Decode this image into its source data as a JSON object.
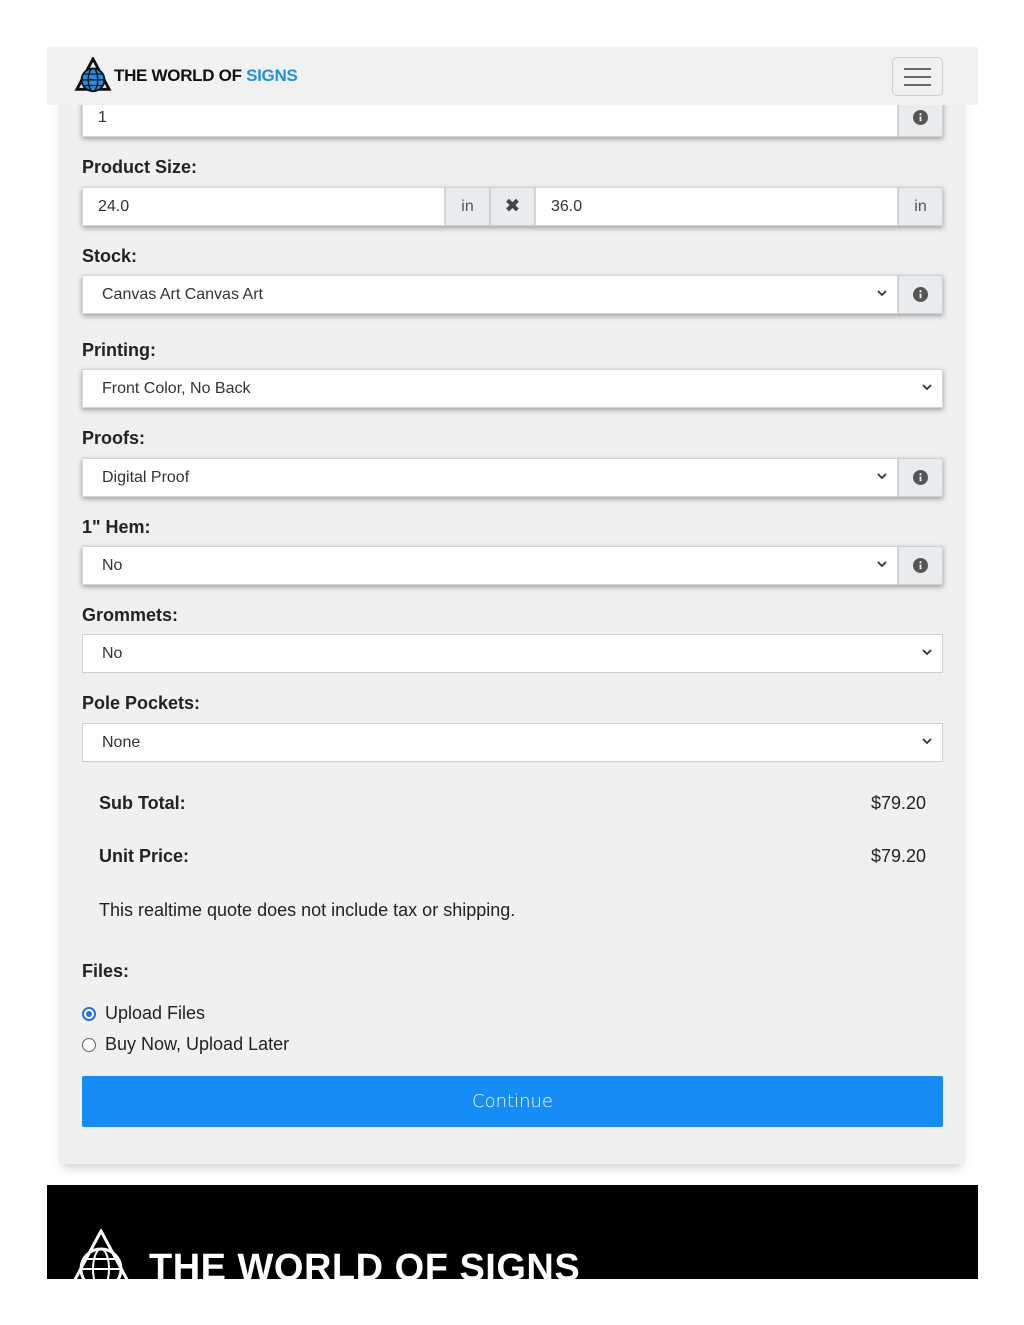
{
  "header": {
    "logo_dark": "THE WORLD OF ",
    "logo_blue": "SIGNS"
  },
  "form": {
    "quantity_value": "1",
    "product_size": {
      "label": "Product Size:",
      "width": "24.0",
      "width_unit": "in",
      "height": "36.0",
      "height_unit": "in",
      "times_symbol": "✖"
    },
    "stock": {
      "label": "Stock:",
      "value": "Canvas Art Canvas Art"
    },
    "printing": {
      "label": "Printing:",
      "value": "Front Color, No Back"
    },
    "proofs": {
      "label": "Proofs:",
      "value": "Digital Proof"
    },
    "hem": {
      "label": "1\" Hem:",
      "value": "No"
    },
    "grommets": {
      "label": "Grommets:",
      "value": "No"
    },
    "pole_pockets": {
      "label": "Pole Pockets:",
      "value": "None"
    }
  },
  "totals": {
    "subtotal_label": "Sub Total:",
    "subtotal_value": "$79.20",
    "unit_price_label": "Unit Price:",
    "unit_price_value": "$79.20",
    "note": "This realtime quote does not include tax or shipping."
  },
  "files": {
    "label": "Files:",
    "options": [
      {
        "label": "Upload Files",
        "checked": true
      },
      {
        "label": "Buy Now, Upload Later",
        "checked": false
      }
    ]
  },
  "continue_label": "Continue",
  "footer": {
    "logo_text": "THE WORLD OF SIGNS"
  },
  "colors": {
    "accent": "#158df6",
    "brand_blue": "#1e90e8"
  }
}
